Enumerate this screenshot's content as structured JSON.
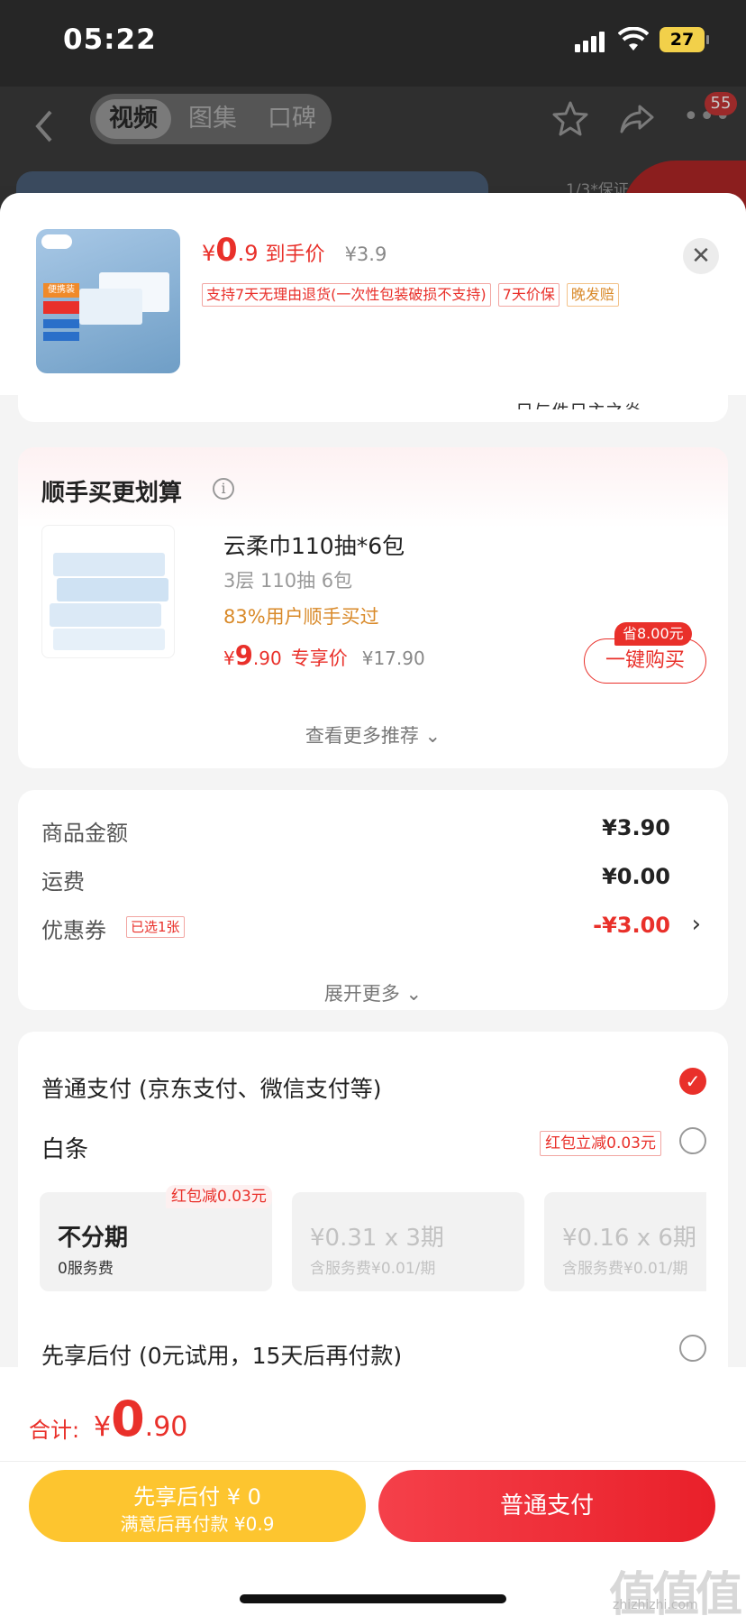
{
  "status_bar": {
    "time": "05:22",
    "battery": "27"
  },
  "nav": {
    "tabs": [
      "视频",
      "图集",
      "口碑"
    ],
    "active_tab": 0,
    "badge": "55",
    "bg_text": "1/3*保证"
  },
  "product": {
    "price_symbol": "¥",
    "price_int": "0",
    "price_dec": ".9",
    "price_label": "到手价",
    "original_price": "¥3.9",
    "tags": [
      "支持7天无理由退货(一次性包装破损不支持)",
      "7天价保",
      "晚发赔"
    ],
    "thumb_text": "便携装"
  },
  "address_snippet": "日与件日主之炎",
  "recommend": {
    "title": "顺手买更划算",
    "name": "云柔巾110抽*6包",
    "spec": "3层 110抽 6包",
    "social_proof": "83%用户顺手买过",
    "price_symbol": "¥",
    "price_int": "9",
    "price_dec": ".90",
    "price_label": "专享价",
    "original_price": "¥17.90",
    "save_badge": "省8.00元",
    "buy_button": "一键购买",
    "more_link": "查看更多推荐 ⌄"
  },
  "amounts": {
    "rows": [
      {
        "label": "商品金额",
        "value": "¥3.90"
      },
      {
        "label": "运费",
        "value": "¥0.00"
      },
      {
        "label": "优惠券",
        "value": "-¥3.00"
      }
    ],
    "coupon_tag": "已选1张",
    "expand_link": "展开更多 ⌄"
  },
  "payment": {
    "normal_label": "普通支付 (京东支付、微信支付等)",
    "baitiao_label": "白条",
    "baitiao_promo": "红包立减0.03元",
    "installments": [
      {
        "main": "不分期",
        "sub": "0服务费",
        "promo": "红包减0.03元"
      },
      {
        "main": "¥0.31 x 3期",
        "sub": "含服务费¥0.01/期"
      },
      {
        "main": "¥0.16 x 6期",
        "sub": "含服务费¥0.01/期"
      }
    ],
    "pay_later_label": "先享后付 (0元试用，15天后再付款)"
  },
  "bottom": {
    "total_label": "合计:",
    "total_symbol": "¥",
    "total_int": "0",
    "total_dec": ".90",
    "later_line1": "先享后付 ¥ 0",
    "later_line2": "满意后再付款 ¥0.9",
    "normal_pay": "普通支付"
  },
  "watermark": {
    "main": "值值值",
    "sub": "zhizhizhi.com"
  },
  "colors": {
    "accent": "#e9302a",
    "later_button": "#fdc52f",
    "promo_orange": "#d98a2a"
  }
}
